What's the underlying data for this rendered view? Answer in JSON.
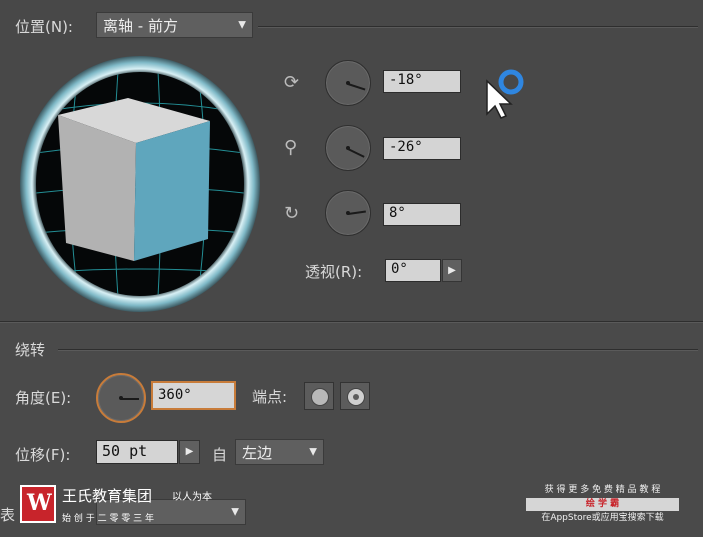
{
  "position": {
    "label": "位置(N):",
    "preset": "离轴 - 前方"
  },
  "rotation_axes": [
    {
      "icon": "x-axis-rotate-icon",
      "glyph": "⟳",
      "value": "-18°"
    },
    {
      "icon": "y-axis-rotate-icon",
      "glyph": "⚲",
      "value": "-26°"
    },
    {
      "icon": "z-axis-rotate-icon",
      "glyph": "↻",
      "value": "8°"
    }
  ],
  "perspective": {
    "label": "透视(R):",
    "value": "0°"
  },
  "revolve": {
    "section_title": "绕转",
    "angle_label": "角度(E):",
    "angle_value": "360°",
    "cap_label": "端点:",
    "offset_label": "位移(F):",
    "offset_value": "50 pt",
    "from_label": "自",
    "from_value": "左边"
  },
  "surface": {
    "label_partial": "表"
  },
  "watermark": {
    "brand": "王氏教育集团",
    "slogan": "以人为本",
    "motto": "始 创 于 二 零 零 三 年",
    "right_line1": "获 得 更 多 免 费 精 品 教 程",
    "right_line2": "绘 学 霸",
    "right_line3": "在AppStore或应用宝搜索下载"
  },
  "colors": {
    "cube_front": "#5fa6bd",
    "cube_top": "#d8d8d8",
    "cube_left": "#b2b2b2",
    "ring": "#9ed0dc",
    "grid": "#2bb0b8",
    "angle_border": "#c87c3a",
    "cursor_ring": "#2f86e0"
  }
}
